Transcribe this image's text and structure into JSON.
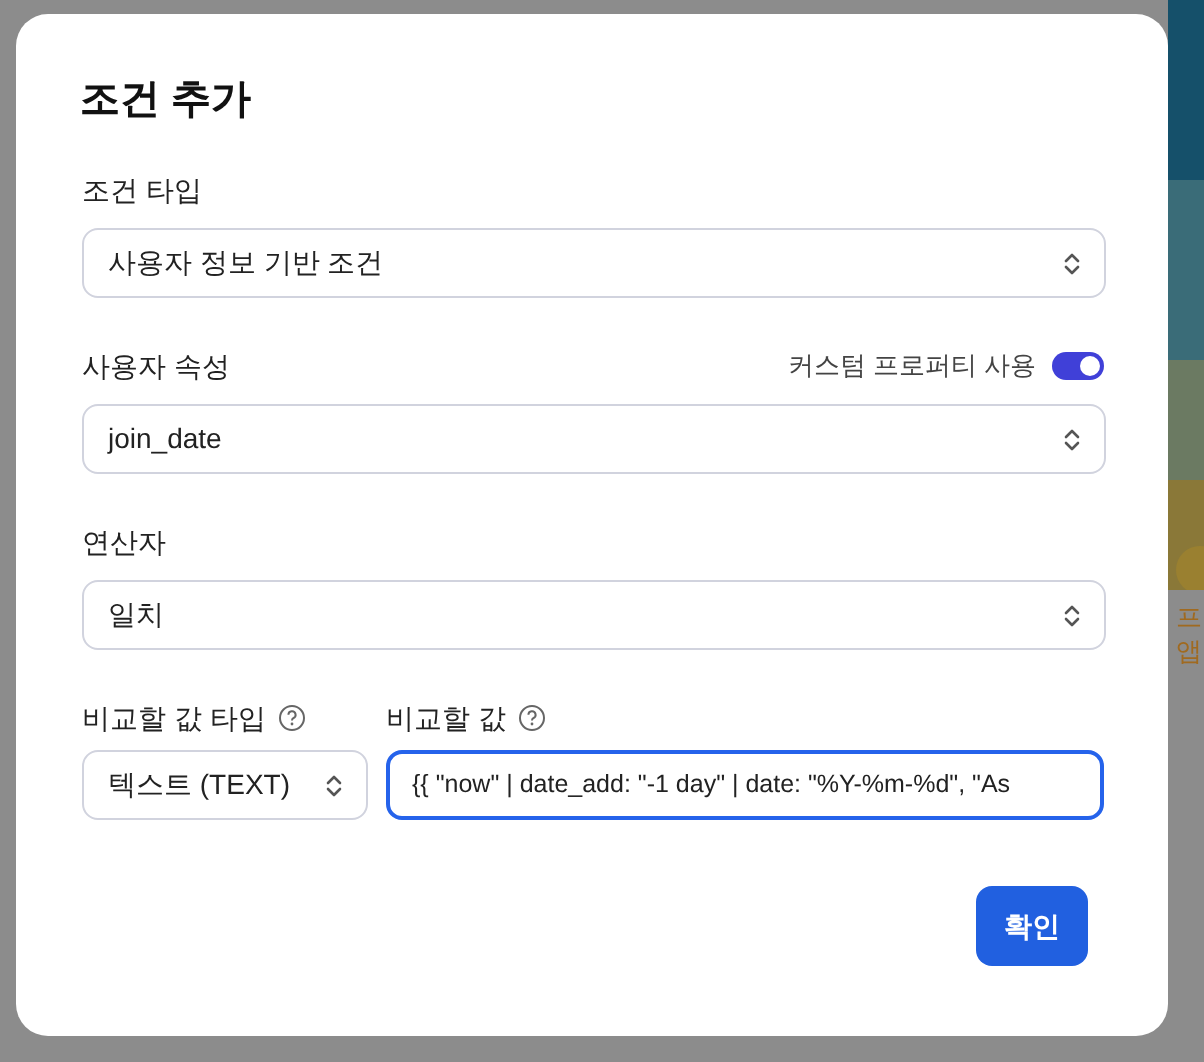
{
  "background": {
    "fragments": [
      "프",
      "앱"
    ]
  },
  "dialog": {
    "title": "조건 추가",
    "fields": [
      {
        "kind": "select",
        "label": "조건 타입",
        "value": "사용자 정보 기반 조건"
      },
      {
        "kind": "select",
        "label": "사용자 속성",
        "value": "join_date",
        "toggle": {
          "label": "커스텀 프로퍼티 사용",
          "on": true
        }
      },
      {
        "kind": "select",
        "label": "연산자",
        "value": "일치"
      }
    ],
    "value_row": {
      "type_label": "비교할 값 타입",
      "type_value": "텍스트 (TEXT)",
      "value_label": "비교할 값",
      "value": "{{ \"now\" | date_add: \"-1 day\" | date: \"%Y-%m-%d\", \"As",
      "focused": true
    },
    "confirm": "확인"
  }
}
